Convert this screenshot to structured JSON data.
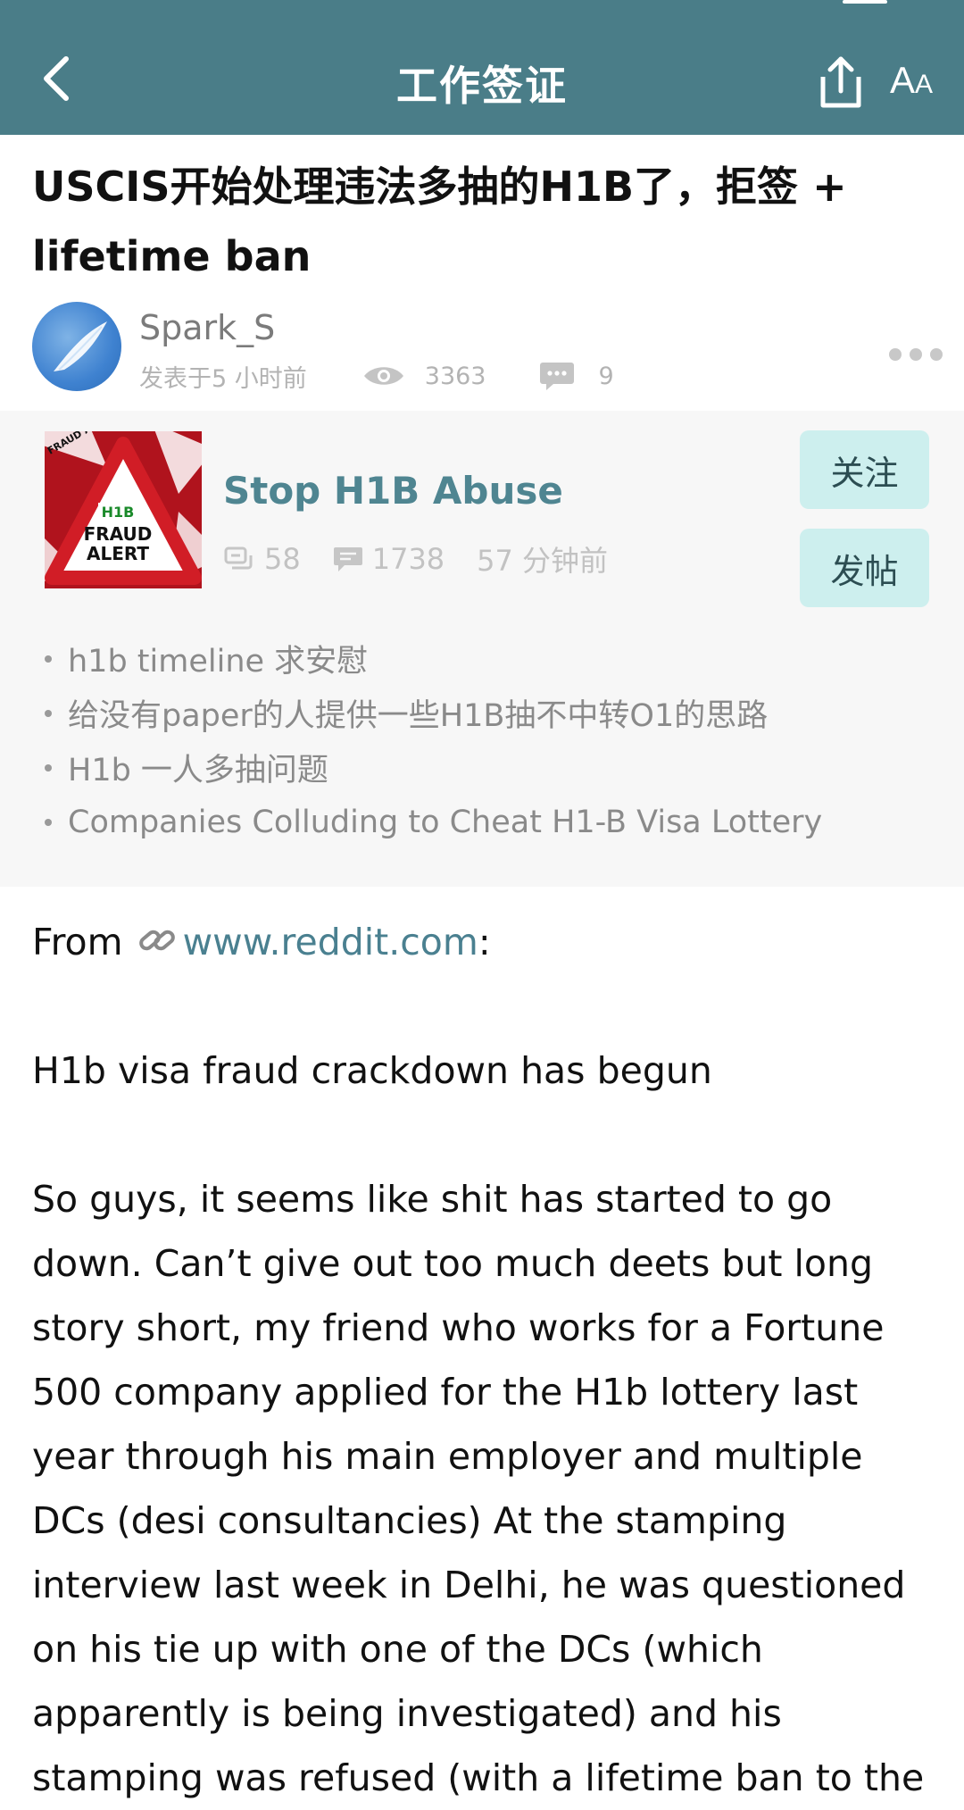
{
  "header": {
    "title": "工作签证",
    "font_button_big": "A",
    "font_button_small": "A"
  },
  "post": {
    "title": "USCIS开始处理违法多抽的H1B了，拒签 + lifetime ban",
    "author": "Spark_S",
    "posted_time": "发表于5 小时前",
    "views": "3363",
    "comments": "9"
  },
  "group": {
    "name": "Stop H1B Abuse",
    "members": "58",
    "posts": "1738",
    "last_active": "57 分钟前",
    "follow_label": "关注",
    "post_label": "发帖",
    "thumb_text": {
      "badge": "H1B",
      "line1": "FRAUD",
      "line2": "ALERT",
      "corner": "FRAUD ALERT"
    },
    "related": [
      "h1b timeline 求安慰",
      "给没有paper的人提供一些H1B抽不中转O1的思路",
      "H1b 一人多抽问题",
      "Companies Colluding to Cheat H1-B Visa Lottery"
    ]
  },
  "body": {
    "from_label": "From",
    "link_text": "www.reddit.com",
    "link_suffix": ":",
    "heading": "H1b visa fraud crackdown has begun",
    "paragraph": "So guys, it seems like shit has started to go down. Can’t give out too much deets but long story short, my friend who works for a Fortune 500 company applied for the H1b lottery last year through his main employer and multiple DCs (desi consultancies) At the stamping interview last week in Delhi, he was questioned on his tie up with one of the DCs (which apparently is being investigated) and his stamping was refused (with a lifetime ban to the"
  },
  "colors": {
    "header_bg": "#4a7d88",
    "accent": "#4f8591",
    "button_bg": "#cdefee",
    "card_bg": "#f7f7f7"
  }
}
